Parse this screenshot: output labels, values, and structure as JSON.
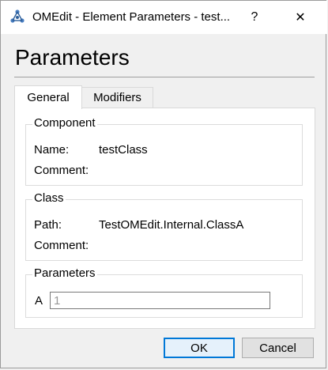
{
  "window": {
    "title": "OMEdit - Element Parameters - test...",
    "help_glyph": "?",
    "close_glyph": "✕"
  },
  "heading": "Parameters",
  "tabs": [
    {
      "label": "General",
      "active": true
    },
    {
      "label": "Modifiers",
      "active": false
    }
  ],
  "component": {
    "title": "Component",
    "name_label": "Name:",
    "name_value": "testClass",
    "comment_label": "Comment:",
    "comment_value": ""
  },
  "class": {
    "title": "Class",
    "path_label": "Path:",
    "path_value": "TestOMEdit.Internal.ClassA",
    "comment_label": "Comment:",
    "comment_value": ""
  },
  "parameters": {
    "title": "Parameters",
    "items": [
      {
        "label": "A",
        "placeholder": "1",
        "value": ""
      }
    ]
  },
  "buttons": {
    "ok": "OK",
    "cancel": "Cancel"
  },
  "colors": {
    "accent": "#0078d7",
    "panel_bg": "#ffffff",
    "dialog_bg": "#f0f0f0"
  }
}
